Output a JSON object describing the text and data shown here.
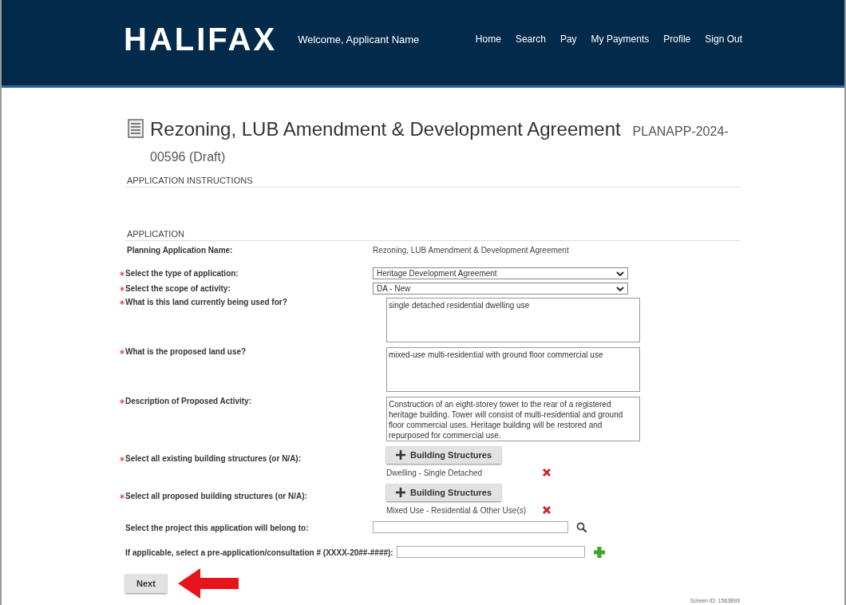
{
  "header": {
    "logo": "HALIFAX",
    "welcome": "Welcome, Applicant Name",
    "nav": [
      "Home",
      "Search",
      "Pay",
      "My Payments",
      "Profile",
      "Sign Out"
    ]
  },
  "title": {
    "main": "Rezoning, LUB Amendment & Development Agreement",
    "number": "PLANAPP-2024-00596 (Draft)"
  },
  "sections": [
    {
      "heading": "APPLICATION INSTRUCTIONS"
    },
    {
      "heading": "APPLICATION"
    }
  ],
  "fields": [
    {
      "kind": "text",
      "label": "Planning Application Name:",
      "required": false,
      "value": "Rezoning, LUB Amendment & Development Agreement"
    },
    {
      "kind": "select",
      "label": "Select the type of application:",
      "required": true,
      "value": "Heritage Development Agreement"
    },
    {
      "kind": "select",
      "label": "Select the scope of activity:",
      "required": true,
      "value": "DA - New"
    },
    {
      "kind": "textarea",
      "label": "What is this land currently being used for?",
      "required": true,
      "value": "single detached residential dwelling use"
    },
    {
      "kind": "textarea",
      "label": "What is the proposed land use?",
      "required": true,
      "value": "mixed-use multi-residential with ground floor commercial use"
    },
    {
      "kind": "textarea",
      "label": "Description of Proposed Activity:",
      "required": true,
      "value": "Construction of an eight-storey tower to the rear of a registered heritage building. Tower will consist of multi-residential and ground floor commercial uses. Heritage building will be restored and repurposed for commercial use."
    },
    {
      "kind": "picker",
      "label": "Select all existing building structures (or N/A):",
      "required": true,
      "button": "Building Structures",
      "items": [
        "Dwelling - Single Detached"
      ]
    },
    {
      "kind": "picker",
      "label": "Select all proposed building structures (or N/A):",
      "required": true,
      "button": "Building Structures",
      "items": [
        "Mixed Use - Residential & Other Use(s)"
      ]
    },
    {
      "kind": "lookup",
      "label": "Select the project this application will belong to:",
      "required": false
    },
    {
      "kind": "add",
      "label": "If applicable, select a pre-application/consultation # (XXXX-20##-####):",
      "required": false
    }
  ],
  "next_button": "Next",
  "screen_id": "Screen ID: 1563893"
}
